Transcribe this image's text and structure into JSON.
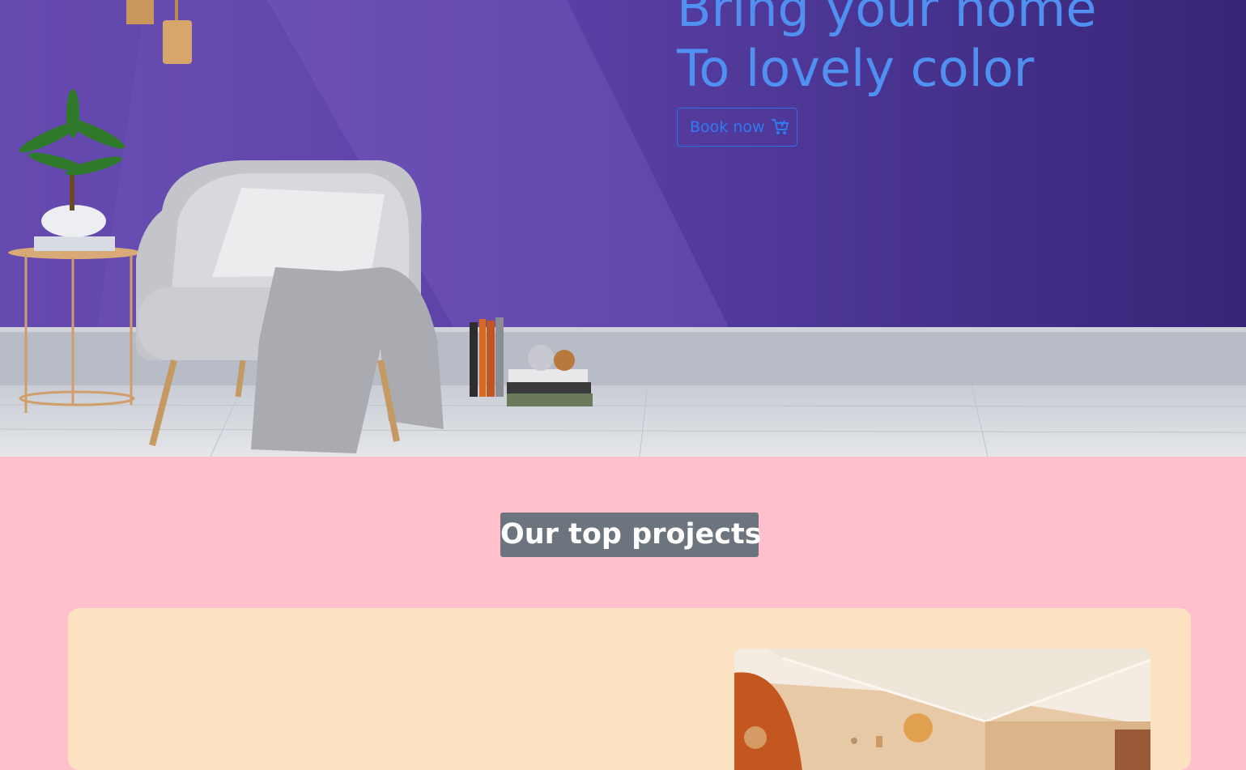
{
  "hero": {
    "title_line1": "Bring your home",
    "title_line2": "To lovely color",
    "button_label": "Book now",
    "button_icon": "cart-icon",
    "image": "living-room-purple-wall"
  },
  "projects": {
    "heading": "Our top projects",
    "image": "room-with-orange-circles"
  },
  "colors": {
    "page_background": "#ffbfcb",
    "hero_wall": "#4a3694",
    "title": "#4f90f0",
    "button_border": "#2f6ee6",
    "heading_background": "#6c757d",
    "card_background": "#fde3c2"
  }
}
